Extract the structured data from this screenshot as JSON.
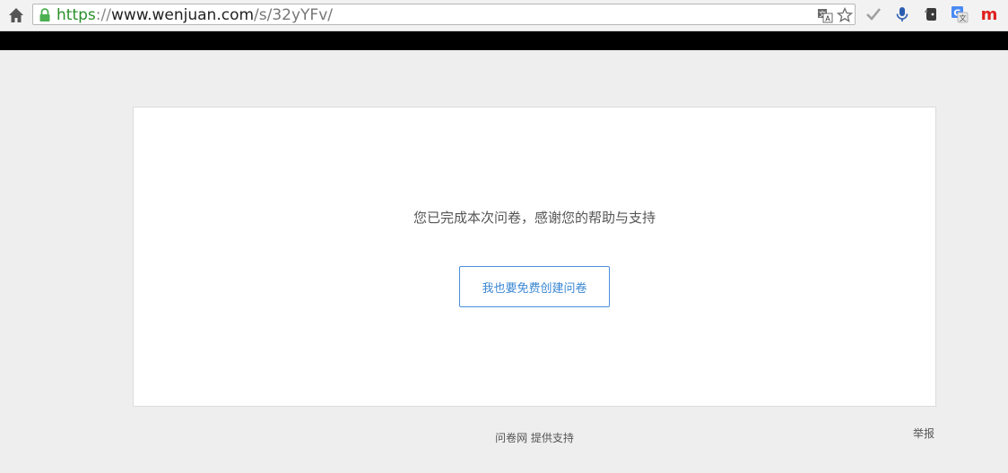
{
  "browser": {
    "url_scheme": "https",
    "url_separator": "://",
    "url_host": "www.wenjuan.com",
    "url_path": "/s/32yYFv/",
    "icons": [
      "home-icon",
      "lock-icon",
      "translate-icon",
      "star-icon",
      "check-icon",
      "microphone-icon",
      "evernote-icon",
      "google-translate-icon",
      "m-extension-icon"
    ],
    "colors": {
      "lock": "#4caf50",
      "mic": "#2a5db0",
      "google_translate": "#4a8af4",
      "m_extension": "#e0201c"
    }
  },
  "survey": {
    "thanks_message": "您已完成本次问卷，感谢您的帮助与支持",
    "create_button_label": "我也要免费创建问卷",
    "accent_color": "#4a90d9"
  },
  "footer": {
    "powered_by": "问卷网 提供支持",
    "report_label": "举报"
  }
}
